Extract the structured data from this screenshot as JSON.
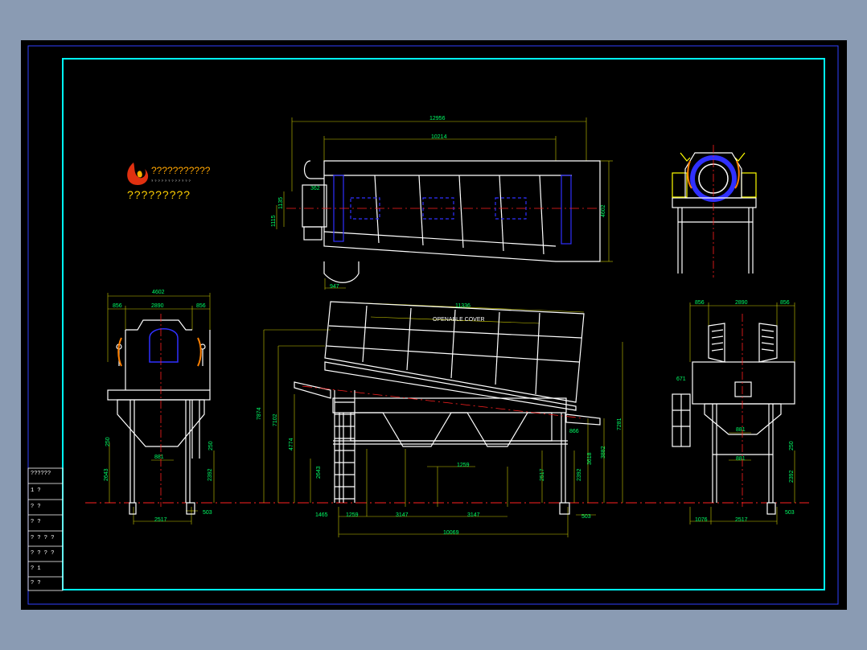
{
  "logo": {
    "title": "???????????",
    "subtitle": "?????????",
    "tagline": "????????????"
  },
  "plan_view": {
    "dims": [
      "12956",
      "10214",
      "4602",
      "1115",
      "1135",
      "362",
      "947"
    ]
  },
  "front_view": {
    "cover_label": "OPENABLE COVER",
    "dims": [
      "11336",
      "7874",
      "7102",
      "4774",
      "2643",
      "1465",
      "1259",
      "3147",
      "3147",
      "10069",
      "1259",
      "2517",
      "2392",
      "3618",
      "3882",
      "7281",
      "503",
      "866"
    ]
  },
  "left_view": {
    "dims": [
      "4602",
      "856",
      "2890",
      "856",
      "881",
      "2643",
      "2392",
      "2517",
      "503",
      "250",
      "250"
    ]
  },
  "right_view": {
    "dims": [
      "856",
      "2890",
      "856",
      "671",
      "881",
      "881",
      "2392",
      "1076",
      "2517",
      "503",
      "250"
    ]
  },
  "title_block": {
    "rows": [
      "??????",
      "1   ?",
      "?   ?",
      "?   ?",
      "? ? ? ?",
      "? ? ? ?",
      "?   1",
      "?   ?"
    ]
  },
  "colors": {
    "background": "#8a9bb3",
    "sheet": "#000000",
    "frame": "#00ffff",
    "outline": "#ffffff",
    "dimension": "#00ff66",
    "centerline": "#ff2020",
    "yellow": "#ffff00",
    "blue": "#3030ff"
  }
}
